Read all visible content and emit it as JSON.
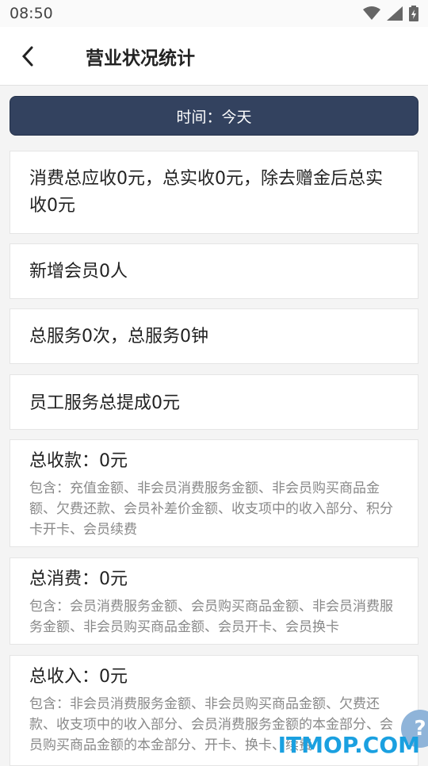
{
  "status_bar": {
    "time": "08:50"
  },
  "header": {
    "title": "营业状况统计"
  },
  "filter": {
    "label": "时间：今天"
  },
  "cards": [
    {
      "text": "消费总应收0元，总实收0元，除去赠金后总实收0元"
    },
    {
      "text": "新增会员0人"
    },
    {
      "text": "总服务0次，总服务0钟"
    },
    {
      "text": "员工服务总提成0元"
    },
    {
      "text": "总收款：0元",
      "detail": "包含：充值金额、非会员消费服务金额、非会员购买商品金额、欠费还款、会员补差价金额、收支项中的收入部分、积分卡开卡、会员续费"
    },
    {
      "text": "总消费：0元",
      "detail": "包含：会员消费服务金额、会员购买商品金额、非会员消费服务金额、非会员购买商品金额、会员开卡、会员换卡"
    },
    {
      "text": "总收入：0元",
      "detail": "包含：非会员消费服务金额、非会员购买商品金额、欠费还款、收支项中的收入部分、会员消费服务金额的本金部分、会员购买商品金额的本金部分、开卡、换卡、续费"
    }
  ],
  "watermark": "ITMOP.COM",
  "help_button": {
    "symbol": "?"
  },
  "icons": {
    "back": "chevron-left-icon",
    "wifi": "wifi-icon",
    "signal": "signal-icon",
    "battery": "battery-icon"
  }
}
